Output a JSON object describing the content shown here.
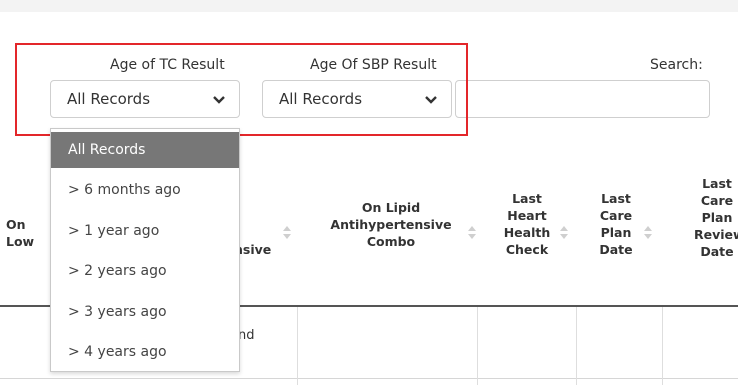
{
  "filters": {
    "tc": {
      "label": "Age of TC Result",
      "value": "All Records"
    },
    "sbp": {
      "label": "Age Of SBP Result",
      "value": "All Records"
    }
  },
  "search": {
    "label": "Search:",
    "value": ""
  },
  "table": {
    "headers": {
      "col_a_line1": "On",
      "col_a_line2": "Low",
      "col_b": "nsive",
      "col_c_line1": "On Lipid",
      "col_c_line2": "Antihypertensive",
      "col_c_line3": "Combo",
      "col_d_line1": "Last",
      "col_d_line2": "Heart",
      "col_d_line3": "Health",
      "col_d_line4": "Check",
      "col_e_line1": "Last",
      "col_e_line2": "Care",
      "col_e_line3": "Plan",
      "col_e_line4": "Date",
      "col_f_line1": "Last",
      "col_f_line2": "Care",
      "col_f_line3": "Plan",
      "col_f_line4": "Review",
      "col_f_line5": "Date"
    },
    "row1_fragment": "nd"
  },
  "dropdown": {
    "items": [
      {
        "label": "All Records",
        "selected": true
      },
      {
        "label": "> 6 months ago",
        "selected": false
      },
      {
        "label": "> 1 year ago",
        "selected": false
      },
      {
        "label": "> 2 years ago",
        "selected": false
      },
      {
        "label": "> 3 years ago",
        "selected": false
      },
      {
        "label": "> 4 years ago",
        "selected": false
      }
    ]
  },
  "icons": {
    "select_caret": "chevron-down-icon",
    "sort": "sort-both-icon"
  },
  "colors": {
    "highlight": "#e3262a",
    "selected_option_bg": "#777777"
  }
}
